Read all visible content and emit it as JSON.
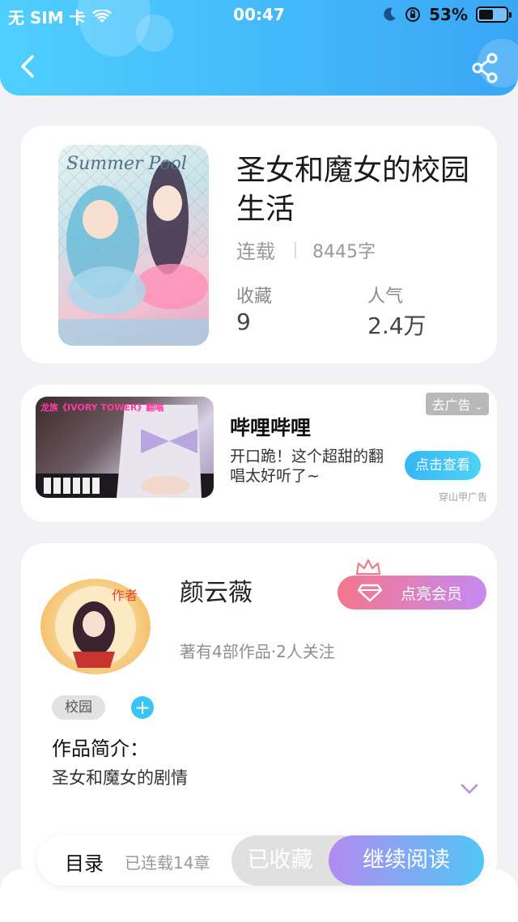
{
  "status_bar": {
    "carrier": "无 SIM 卡",
    "time": "00:47",
    "battery": "53%",
    "battery_level": 0.53
  },
  "header": {
    "back_icon": "chevron-left-icon",
    "share_icon": "share-icon",
    "gradient": [
      "#4fcfff",
      "#3aa6f5"
    ]
  },
  "book": {
    "title": "圣女和魔女的校园生活",
    "status": "连载",
    "word_count": "8445字",
    "stats": [
      {
        "label": "收藏",
        "value": "9"
      },
      {
        "label": "人气",
        "value": "2.4万"
      }
    ],
    "cover_text": "Summer Pool"
  },
  "ad": {
    "title": "哔哩哔哩",
    "description": "开口跪！这个超甜的翻唱太好听了~",
    "tag": "去广告",
    "cta": "点击查看",
    "source": "穿山甲广告",
    "banner": "龙族《IVORY TOWER》翻唱"
  },
  "author": {
    "name": "颜云薇",
    "vip_button": "点亮会员",
    "meta": "著有4部作品·2人关注",
    "avatar_badge": "作者",
    "tags": [
      "校园"
    ],
    "add_tag_label": "+",
    "intro_label": "作品简介：",
    "intro_text": "圣女和魔女的剧情"
  },
  "bottom_bar": {
    "toc_label": "目录",
    "chapter_count": "已连载14章",
    "favorited_label": "已收藏",
    "read_label": "继续阅读"
  },
  "colors": {
    "accent_blue": "#39c4f6",
    "vip_gradient": [
      "#f4768b",
      "#c68af2"
    ],
    "read_gradient": [
      "#b38bf0",
      "#4fc6f6"
    ]
  }
}
